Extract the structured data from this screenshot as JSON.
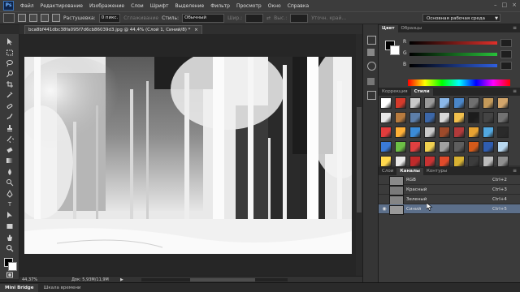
{
  "app": {
    "logo": "Ps"
  },
  "menu": [
    "Файл",
    "Редактирование",
    "Изображение",
    "Слои",
    "Шрифт",
    "Выделение",
    "Фильтр",
    "Просмотр",
    "Окно",
    "Справка"
  ],
  "options": {
    "feather_label": "Растушевка:",
    "feather_value": "0 пикс.",
    "antialias_label": "Сглаживание",
    "style_label": "Стиль:",
    "style_value": "Обычный",
    "width_label": "Шир.:",
    "height_label": "Выс.:",
    "refine_label": "Уточн. край..."
  },
  "workspace": {
    "label": "Основная рабочая среда"
  },
  "document": {
    "tab_title": "bca8bf441dbc38fa095f7d6cb86039d3.jpg @ 44,4% (Слой 1, Синий/8) *",
    "zoom": "44,37%",
    "doc_size": "Док: 5,93M/11,9M"
  },
  "bottom_tabs": [
    "Mini Bridge",
    "Шкала времени"
  ],
  "color_panel": {
    "tabs": [
      "Цвет",
      "Образцы"
    ],
    "sliders": [
      {
        "letter": "R",
        "value": "",
        "color": "#e0302a"
      },
      {
        "letter": "G",
        "value": "",
        "color": "#28c23a"
      },
      {
        "letter": "B",
        "value": "",
        "color": "#2f5fe0"
      }
    ]
  },
  "styles_panel": {
    "tabs": [
      "Коррекция",
      "Стили"
    ],
    "swatches": [
      "#ffffff",
      "#d53a2b",
      "#c8c8c8",
      "#9a9a9a",
      "#8ab7e8",
      "#4a86c8",
      "#6f6f6f",
      "#c49a5a",
      "#d2a56b",
      "#e8e8e8",
      "#b87b3e",
      "#5d7ea8",
      "#3c67a8",
      "#d9d9d9",
      "#f2c04d",
      "#1c1c1c",
      "#444444",
      "#727272",
      "#e23c3c",
      "#ffb037",
      "#3b8cd8",
      "#c9c9c9",
      "#9d4a2a",
      "#b23a3a",
      "#e6a232",
      "#52a8e0",
      "#2a2a2a",
      "#3a7ad8",
      "#6cbf45",
      "#e04040",
      "#f0d050",
      "#a0a0a0",
      "#5e5e5e",
      "#d45a1a",
      "#2f5db0",
      "#b8d8f0",
      "#ffd84d",
      "#e8e8e8",
      "#c02a2a",
      "#c83232",
      "#e04a2a",
      "#d8b232",
      "#3c3c3c",
      "#bdbdbd",
      "#8f8f8f"
    ]
  },
  "channels_panel": {
    "tabs": [
      "Слои",
      "Каналы",
      "Контуры"
    ],
    "channels": [
      {
        "name": "RGB",
        "shortcut": "Ctrl+2",
        "selected": false
      },
      {
        "name": "Красный",
        "shortcut": "Ctrl+3",
        "selected": false
      },
      {
        "name": "Зеленый",
        "shortcut": "Ctrl+4",
        "selected": false
      },
      {
        "name": "Синий",
        "shortcut": "Ctrl+5",
        "selected": true
      }
    ]
  }
}
